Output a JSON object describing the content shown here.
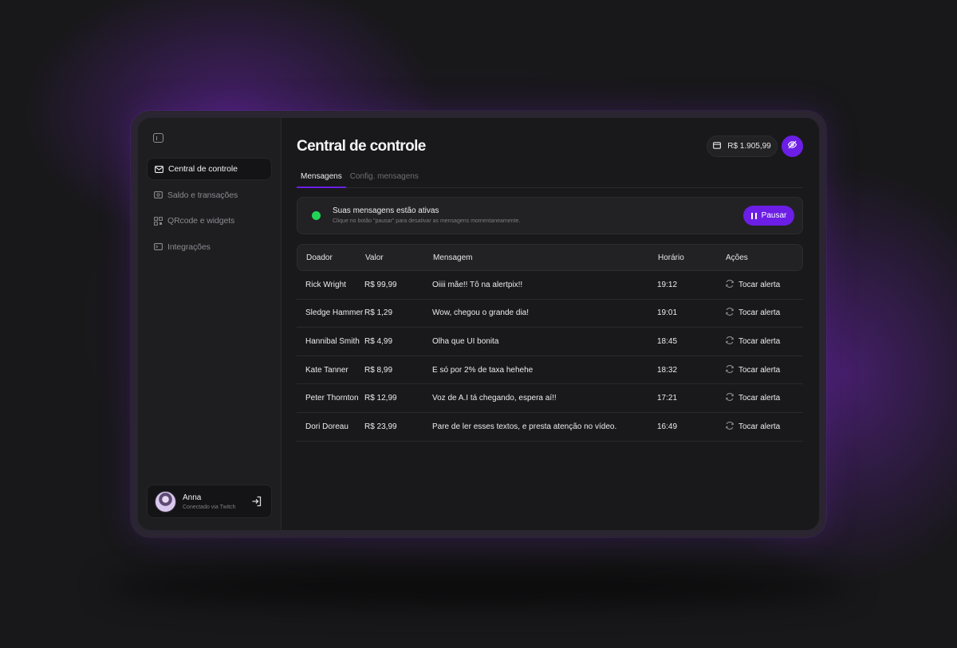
{
  "sidebar": {
    "items": [
      {
        "label": "Central de controle",
        "icon": "mail-icon",
        "active": true
      },
      {
        "label": "Saldo e transações",
        "icon": "wallet-icon",
        "active": false
      },
      {
        "label": "QRcode e widgets",
        "icon": "qrcode-icon",
        "active": false
      },
      {
        "label": "Integrações",
        "icon": "terminal-icon",
        "active": false
      }
    ],
    "profile": {
      "name": "Anna",
      "subtitle": "Conectado via Twitch"
    }
  },
  "header": {
    "title": "Central de controle",
    "balance": "R$ 1.905,99"
  },
  "tabs": [
    {
      "label": "Mensagens",
      "active": true
    },
    {
      "label": "Config. mensagens",
      "active": false
    }
  ],
  "status": {
    "title": "Suas mensagens estão ativas",
    "description": "Clique no botão \"pausar\" para desativar as mensagens momentaneamente.",
    "button_label": "Pausar",
    "indicator_color": "#23d556"
  },
  "table": {
    "columns": [
      "Doador",
      "Valor",
      "Mensagem",
      "Horário",
      "Ações"
    ],
    "rows": [
      {
        "donor": "Rick Wright",
        "value": "R$ 99,99",
        "message": "Oiiii mãe!! Tô na alertpix!!",
        "time": "19:12",
        "action": "Tocar alerta"
      },
      {
        "donor": "Sledge Hammer",
        "value": "R$ 1,29",
        "message": "Wow, chegou o grande dia!",
        "time": "19:01",
        "action": "Tocar alerta"
      },
      {
        "donor": "Hannibal Smith",
        "value": "R$ 4,99",
        "message": "Olha que UI bonita",
        "time": "18:45",
        "action": "Tocar alerta"
      },
      {
        "donor": "Kate Tanner",
        "value": "R$ 8,99",
        "message": "E só por 2% de taxa hehehe",
        "time": "18:32",
        "action": "Tocar alerta"
      },
      {
        "donor": "Peter Thornton",
        "value": "R$ 12,99",
        "message": "Voz de A.I tá chegando, espera aí!!",
        "time": "17:21",
        "action": "Tocar alerta"
      },
      {
        "donor": "Dori Doreau",
        "value": "R$ 23,99",
        "message": "Pare de ler esses textos, e presta atenção no vídeo.",
        "time": "16:49",
        "action": "Tocar alerta"
      }
    ]
  },
  "colors": {
    "accent": "#6c1ee6",
    "background": "#19191c",
    "active": "#23d556"
  }
}
